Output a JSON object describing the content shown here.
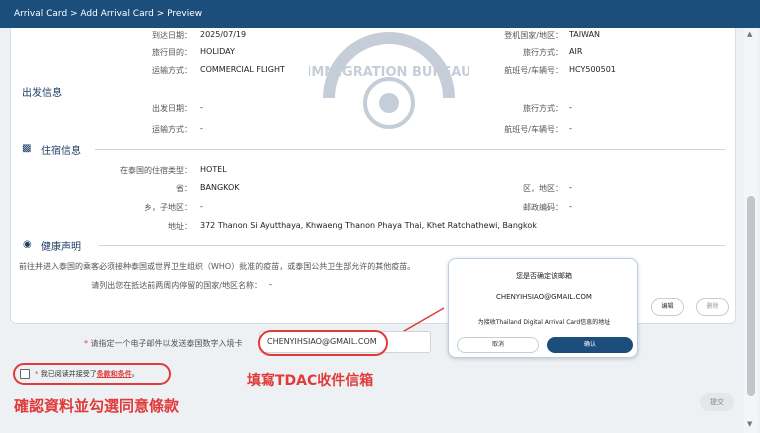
{
  "breadcrumb": "Arrival Card > Add Arrival Card > Preview",
  "arrival": {
    "date_label": "到达日期：",
    "date": "2025/07/19",
    "boarding_country_label": "登机国家/地区：",
    "boarding_country": "TAIWAN",
    "purpose_label": "旅行目的：",
    "purpose": "HOLIDAY",
    "travel_mode_label": "旅行方式：",
    "travel_mode": "AIR",
    "transport_label": "运输方式：",
    "transport": "COMMERCIAL FLIGHT",
    "flight_label": "航班号/车辆号：",
    "flight": "HCY500501"
  },
  "departure": {
    "title": "出发信息",
    "date_label": "出发日期：",
    "date": "-",
    "travel_mode_label": "旅行方式：",
    "travel_mode": "-",
    "transport_label": "运输方式：",
    "transport": "-",
    "flight_label": "航班号/车辆号：",
    "flight": "-"
  },
  "accommodation": {
    "title": "住宿信息",
    "type_label": "在泰国的住宿类型：",
    "type": "HOTEL",
    "province_label": "省：",
    "province": "BANGKOK",
    "district_label": "区，地区：",
    "district": "-",
    "subdistrict_label": "乡，子地区：",
    "subdistrict": "-",
    "postcode_label": "邮政编码：",
    "postcode": "-",
    "address_label": "地址：",
    "address": "372 Thanon Si Ayutthaya, Khwaeng Thanon Phaya Thai, Khet Ratchathewi, Bangkok"
  },
  "health": {
    "title": "健康声明",
    "notice": "前往并进入泰国的乘客必须接种泰国或世界卫生组织（WHO）批准的疫苗，或泰国公共卫生部允许的其他疫苗。",
    "countries_label": "请列出您在抵达前两周内停留的国家/地区名称：",
    "countries": "-"
  },
  "popup": {
    "title": "您是否确定该邮箱",
    "email": "CHENYIHSIAO@GMAIL.COM",
    "purpose": "为接收Thailand Digital Arrival Card信息的地址",
    "cancel": "取消",
    "confirm": "确认"
  },
  "buttons": {
    "edit": "编辑",
    "delete": "删除",
    "submit": "提交"
  },
  "email_field": {
    "label": "请指定一个电子邮件以发送泰国数字入境卡",
    "value": "CHENYIHSIAO@GMAIL.COM"
  },
  "agreement": {
    "prefix": "我已阅读并接受了",
    "link": "条款和条件",
    "suffix": "。"
  },
  "annotations": {
    "email_note": "填寫TDAC收件信箱",
    "agree_note": "確認資料並勾選同意條款"
  },
  "watermark": {
    "text": "IMMIGRATION BUREAU"
  },
  "colors": {
    "header": "#1c4e7c",
    "annotation": "#e03a3a",
    "required": "#e03a3a"
  }
}
